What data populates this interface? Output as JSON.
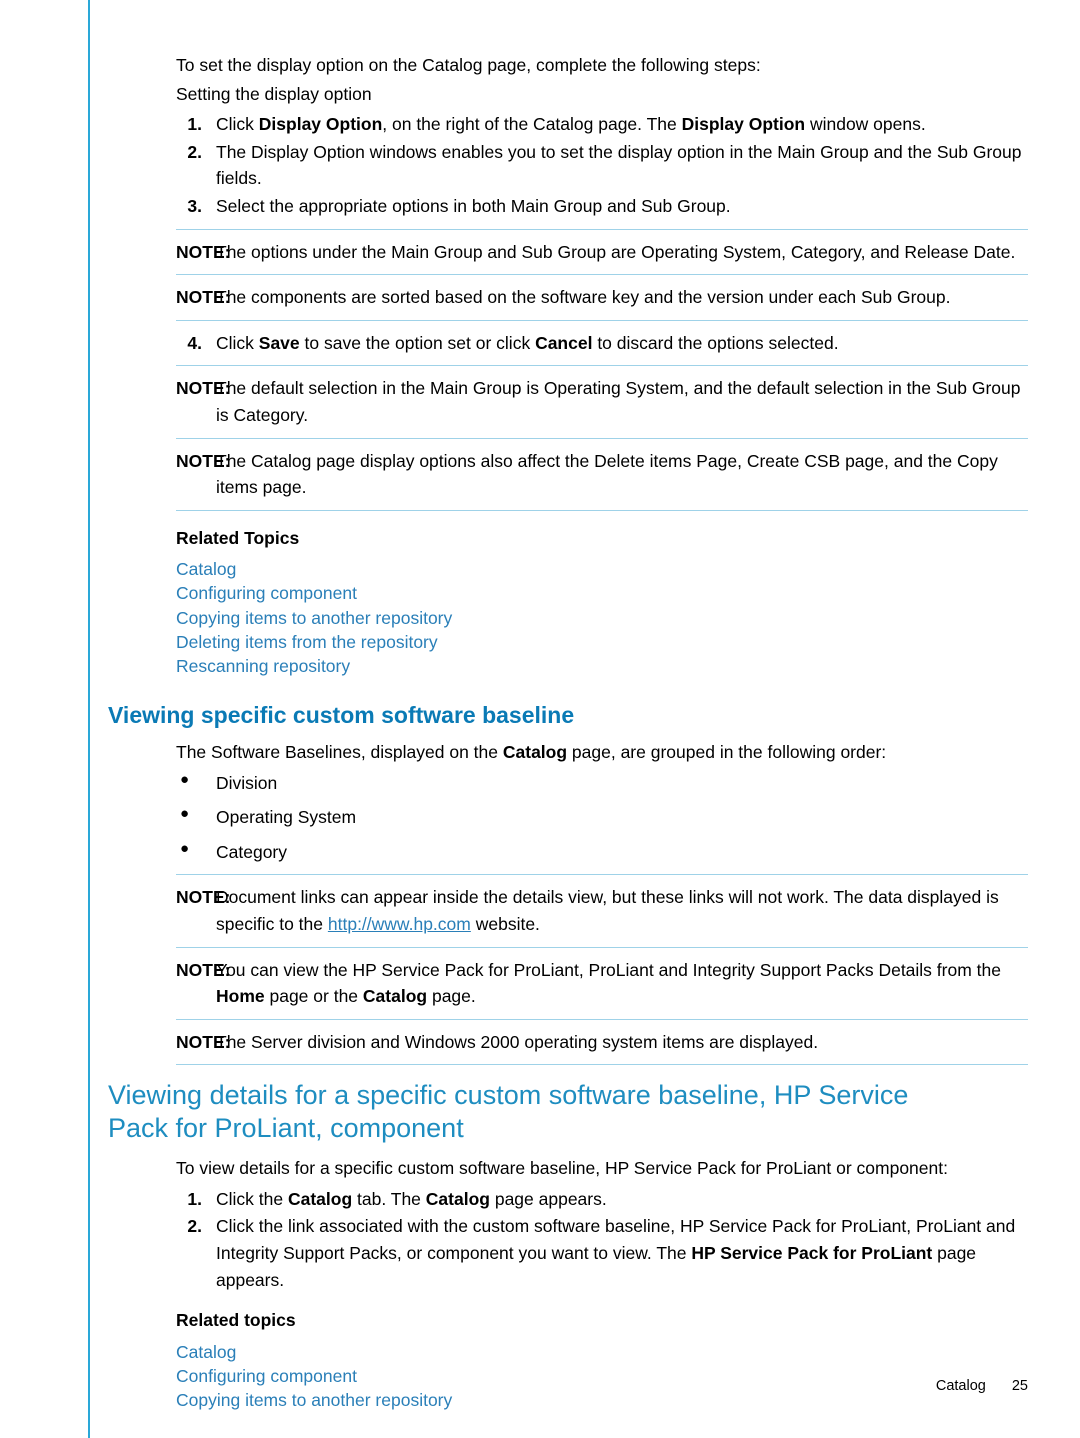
{
  "intro": {
    "line1": "To set the display option on the Catalog page, complete the following steps:",
    "line2": "Setting the display option"
  },
  "steps1": [
    {
      "num": "1.",
      "parts": [
        {
          "t": "Click ",
          "b": false
        },
        {
          "t": "Display Option",
          "b": true
        },
        {
          "t": ", on the right of the Catalog page. The ",
          "b": false
        },
        {
          "t": "Display Option",
          "b": true
        },
        {
          "t": " window opens.",
          "b": false
        }
      ]
    },
    {
      "num": "2.",
      "parts": [
        {
          "t": "The Display Option windows enables you to set the display option in the Main Group and the Sub Group fields.",
          "b": false
        }
      ]
    },
    {
      "num": "3.",
      "parts": [
        {
          "t": "Select the appropriate options in both Main Group and Sub Group.",
          "b": false
        }
      ]
    }
  ],
  "note_label": "NOTE:",
  "notes1": [
    "The options under the Main Group and Sub Group are Operating System, Category, and Release Date.",
    "The components are sorted based on the software key and the version under each Sub Group."
  ],
  "step4": {
    "num": "4.",
    "parts": [
      {
        "t": "Click ",
        "b": false
      },
      {
        "t": "Save",
        "b": true
      },
      {
        "t": " to save the option set or click ",
        "b": false
      },
      {
        "t": "Cancel",
        "b": true
      },
      {
        "t": " to discard the options selected.",
        "b": false
      }
    ]
  },
  "notes2": [
    "The default selection in the Main Group is Operating System, and the default selection in the Sub Group is Category.",
    "The Catalog page display options also affect the Delete items Page, Create CSB page, and the Copy items page."
  ],
  "related1": {
    "title": "Related Topics",
    "links": [
      "Catalog",
      "Configuring component",
      "Copying items to another repository",
      "Deleting items from the repository",
      "Rescanning repository"
    ]
  },
  "section2": {
    "heading": "Viewing specific custom software baseline",
    "intro_parts": [
      {
        "t": "The Software Baselines, displayed on the ",
        "b": false
      },
      {
        "t": "Catalog",
        "b": true
      },
      {
        "t": " page, are grouped in the following order:",
        "b": false
      }
    ],
    "bullets": [
      "Division",
      "Operating System",
      "Category"
    ],
    "note1_parts": [
      {
        "t": "Document links can appear inside the details view, but these links will not work. The data displayed is specific to the ",
        "b": false,
        "link": false
      },
      {
        "t": "http://www.hp.com",
        "b": false,
        "link": true
      },
      {
        "t": " website.",
        "b": false,
        "link": false
      }
    ],
    "note2_parts": [
      {
        "t": "You can view the HP Service Pack for ProLiant, ProLiant and Integrity Support Packs Details from the ",
        "b": false
      },
      {
        "t": "Home",
        "b": true
      },
      {
        "t": " page or the ",
        "b": false
      },
      {
        "t": "Catalog",
        "b": true
      },
      {
        "t": " page.",
        "b": false
      }
    ],
    "note3_parts": [
      {
        "t": "The Server division and Windows 2000 operating system items are displayed.",
        "b": false
      }
    ]
  },
  "section3": {
    "heading_line1": "Viewing details for a specific custom software baseline, HP Service",
    "heading_line2": "Pack for ProLiant, component",
    "intro": "To view details for a specific custom software baseline, HP Service Pack for ProLiant or component:",
    "steps": [
      {
        "num": "1.",
        "parts": [
          {
            "t": "Click the ",
            "b": false
          },
          {
            "t": "Catalog",
            "b": true
          },
          {
            "t": " tab. The ",
            "b": false
          },
          {
            "t": "Catalog",
            "b": true
          },
          {
            "t": " page appears.",
            "b": false
          }
        ]
      },
      {
        "num": "2.",
        "parts": [
          {
            "t": "Click the link associated with the custom software baseline, HP Service Pack for ProLiant, ProLiant and Integrity Support Packs, or component you want to view. The ",
            "b": false
          },
          {
            "t": "HP Service Pack for ProLiant",
            "b": true
          },
          {
            "t": " page appears.",
            "b": false
          }
        ]
      }
    ],
    "related": {
      "title": "Related topics",
      "links": [
        "Catalog",
        "Configuring component",
        "Copying items to another repository"
      ]
    }
  },
  "footer": {
    "label": "Catalog",
    "page": "25"
  },
  "colors": {
    "rule": "#2aa8d8",
    "heading": "#1e8dc0",
    "link": "#2a7fb8"
  }
}
